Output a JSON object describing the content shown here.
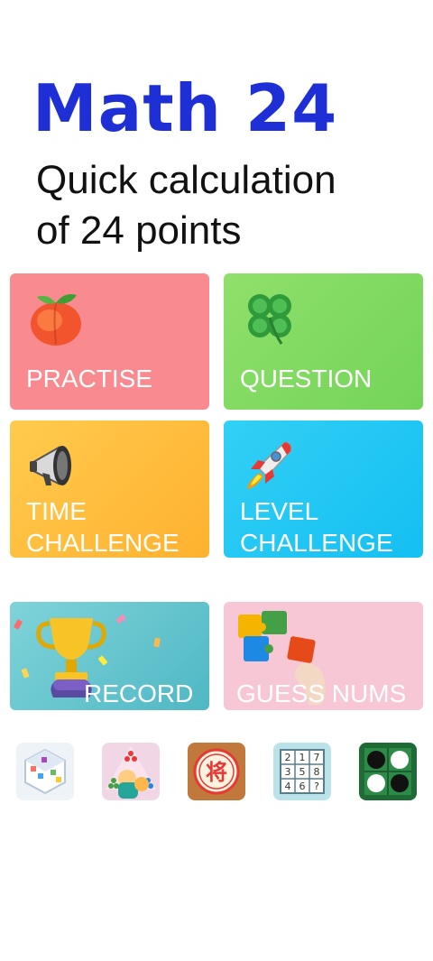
{
  "header": {
    "title": "Math 24",
    "subtitle_line1": "Quick calculation",
    "subtitle_line2": "of 24 points"
  },
  "cards": {
    "practise": {
      "label": "PRACTISE",
      "icon": "peach-icon"
    },
    "question": {
      "label": "QUESTION",
      "icon": "four-leaf-clover-icon"
    },
    "time": {
      "label_line1": "TIME",
      "label_line2": "CHALLENGE",
      "icon": "megaphone-icon"
    },
    "level": {
      "label_line1": "LEVEL",
      "label_line2": "CHALLENGE",
      "icon": "rocket-icon"
    },
    "record": {
      "label": "RECORD",
      "icon": "trophy-icon"
    },
    "guess": {
      "label": "GUESS NUMS",
      "icon": "puzzle-icon"
    }
  },
  "apps": {
    "icons": [
      "math-cube-app-icon",
      "chinese-checkers-app-icon",
      "xiangqi-app-icon",
      "sudoku-numbers-app-icon",
      "reversi-app-icon"
    ],
    "xiangqi_char": "将",
    "numbers_grid": [
      "2",
      "1",
      "7",
      "3",
      "5",
      "8",
      "4",
      "6",
      "?"
    ]
  },
  "colors": {
    "title": "#1f2fd6",
    "practise": "#f98a8f",
    "question": "#7ed861",
    "time": "#ffbe3d",
    "level": "#22c7f3",
    "record": "#5fc2cc",
    "guess": "#f7c7d6"
  }
}
